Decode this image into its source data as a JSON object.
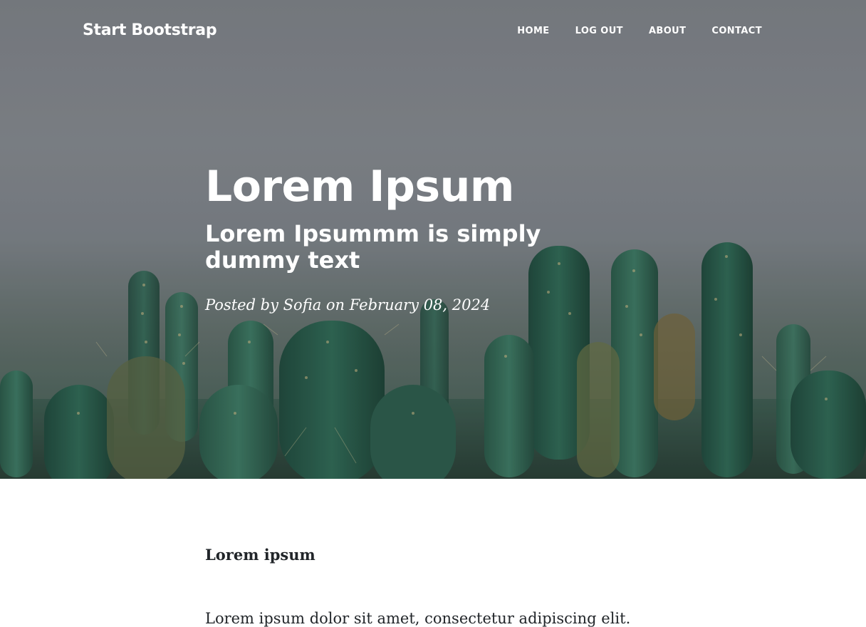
{
  "navbar": {
    "brand": "Start Bootstrap",
    "links": [
      {
        "label": "HOME"
      },
      {
        "label": "LOG OUT"
      },
      {
        "label": "ABOUT"
      },
      {
        "label": "CONTACT"
      }
    ]
  },
  "header": {
    "title": "Lorem Ipsum",
    "subtitle": "Lorem Ipsummm is simply dummy text",
    "meta": "Posted by Sofia on February 08, 2024"
  },
  "post": {
    "section_heading": "Lorem ipsum",
    "paragraph": "Lorem ipsum dolor sit amet, consectetur adipiscing elit."
  },
  "colors": {
    "text_dark": "#212529",
    "header_text": "#ffffff",
    "sky_gray": "#83878c",
    "cactus_green": "#2f5d4a"
  }
}
